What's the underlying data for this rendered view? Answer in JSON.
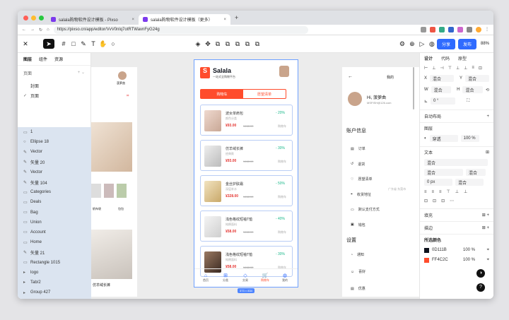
{
  "browser": {
    "tabs": [
      {
        "title": "salala购物软件设计模板 - Pixso"
      },
      {
        "title": "salala购物软件设计模板（更多）"
      }
    ],
    "url": "https://pixso.cn/app/editor/VvV0nlq7otRTWavnFyG24g"
  },
  "editor": {
    "share": "分享",
    "publish": "发布",
    "zoom": "88%"
  },
  "left_panel": {
    "tabs": [
      "图层",
      "组件",
      "资源"
    ],
    "pages_label": "页面",
    "pages": [
      "封面",
      "页面"
    ],
    "layers": [
      "1",
      "Ellipse 18",
      "Vector",
      "矢量 20",
      "Vector",
      "矢量 104",
      "Categories",
      "Deals",
      "Bag",
      "Union",
      "Account",
      "Home",
      "矢量 21",
      "Rectangle 1015",
      "logo",
      "Tab/2",
      "Group 427"
    ]
  },
  "canvas_left": {
    "tag": "菠萝曲",
    "top_item": "",
    "labels": [
      "帆布袋",
      "包包",
      "仿羊绒长裤"
    ]
  },
  "phone": {
    "brand": "Salala",
    "slogan": "一站式全购物平台",
    "tab_cart": "购物车",
    "tab_wish": "愿望清单",
    "items": [
      {
        "name": "波女单肩包",
        "sub": "颜色分类",
        "price": "¥93.00",
        "old": "¥468.00",
        "pct": "- 20%",
        "cart": "购物车"
      },
      {
        "name": "仿羊绒长裤",
        "sub": "经典款",
        "price": "¥93.00",
        "old": "¥468.00",
        "pct": "- 30%",
        "cart": "购物车"
      },
      {
        "name": "金丝护肤霜",
        "sub": "深层补水",
        "price": "¥328.00",
        "old": "¥468.00",
        "pct": "- 50%",
        "cart": "购物车"
      },
      {
        "name": "浅色格纹短袖T恤",
        "sub": "纯棉面料",
        "price": "¥58.00",
        "old": "¥468.00",
        "pct": "- 40%",
        "cart": "购物车"
      },
      {
        "name": "浅色格纹短袖T恤",
        "sub": "纯棉面料",
        "price": "¥58.00",
        "old": "¥468.00",
        "pct": "- 30%",
        "cart": "购物车"
      }
    ],
    "nav": [
      "首页",
      "分类",
      "交易",
      "购物车",
      "我的"
    ],
    "size": "373 × 834"
  },
  "profile": {
    "title": "我的",
    "greeting": "Hi, 菠萝曲",
    "email": "MSFISH@126.com",
    "account_info": "账户信息",
    "menu": [
      "订单",
      "退货",
      "愿望清单",
      "收货地址",
      "默认支付方式",
      "钱包"
    ],
    "address_hint": "广东省 东莞市",
    "settings": "设置",
    "settings_menu": [
      "通知",
      "喜好",
      "优惠"
    ]
  },
  "right_panel": {
    "tabs": [
      "设计",
      "代码",
      "原型"
    ],
    "x": "混合",
    "y": "混合",
    "w": "混合",
    "h": "混合",
    "rotation": "0 °",
    "auto_layout": "自动布局",
    "layer": "图层",
    "blend": "穿透",
    "opacity": "100 %",
    "text": "文本",
    "font1": "混合",
    "font2": "混合",
    "font3": "混合",
    "spacing": "0 px",
    "line": "混合",
    "fill": "填充",
    "stroke": "描边",
    "selected_colors": "所选颜色",
    "colors": [
      {
        "hex": "0D111B",
        "pct": "100 %",
        "swatch": "#0D111B"
      },
      {
        "hex": "FF4C2C",
        "pct": "100 %",
        "swatch": "#FF4C2C"
      }
    ]
  }
}
